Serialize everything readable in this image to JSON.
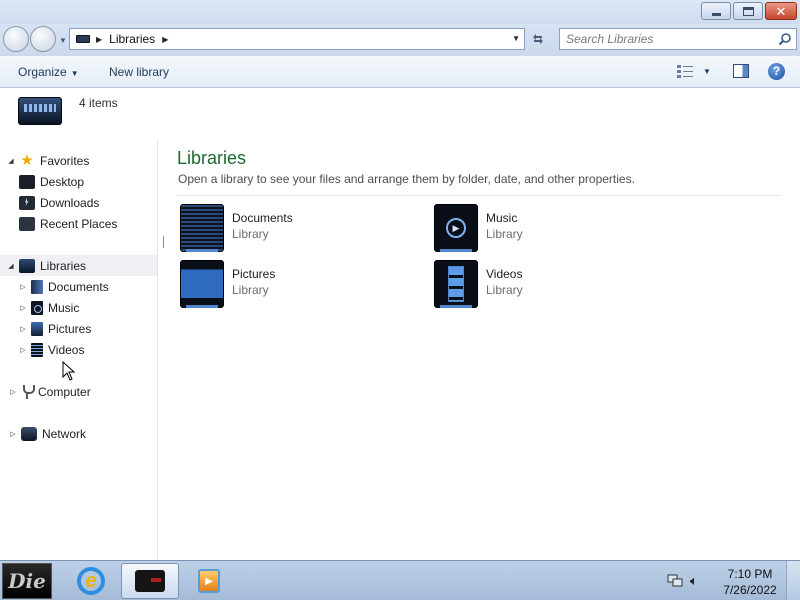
{
  "window": {
    "controls": {
      "minimize_icon": "minimize-icon",
      "maximize_icon": "restore-icon",
      "close_icon": "close-icon"
    }
  },
  "address_bar": {
    "breadcrumbs": [
      "Libraries"
    ],
    "search_placeholder": "Search Libraries"
  },
  "command_bar": {
    "organize_label": "Organize",
    "new_library_label": "New library"
  },
  "details": {
    "item_count": "4 items"
  },
  "navigation": {
    "favorites": {
      "label": "Favorites",
      "items": [
        {
          "label": "Desktop",
          "icon": "desktop-icon"
        },
        {
          "label": "Downloads",
          "icon": "downloads-icon"
        },
        {
          "label": "Recent Places",
          "icon": "recent-places-icon"
        }
      ]
    },
    "libraries": {
      "label": "Libraries",
      "items": [
        {
          "label": "Documents",
          "icon": "documents-icon"
        },
        {
          "label": "Music",
          "icon": "music-icon"
        },
        {
          "label": "Pictures",
          "icon": "pictures-icon"
        },
        {
          "label": "Videos",
          "icon": "videos-icon"
        }
      ]
    },
    "computer": {
      "label": "Computer"
    },
    "network": {
      "label": "Network"
    }
  },
  "main": {
    "title": "Libraries",
    "description": "Open a library to see your files and arrange them by folder, date, and other properties.",
    "libraries": [
      {
        "name": "Documents",
        "type": "Library",
        "icon": "documents-library-icon"
      },
      {
        "name": "Music",
        "type": "Library",
        "icon": "music-library-icon"
      },
      {
        "name": "Pictures",
        "type": "Library",
        "icon": "pictures-library-icon"
      },
      {
        "name": "Videos",
        "type": "Library",
        "icon": "videos-library-icon"
      }
    ]
  },
  "taskbar": {
    "start_label": "Die",
    "time": "7:10 PM",
    "date": "7/26/2022"
  },
  "colors": {
    "title_green": "#1e6b2e",
    "link_blue": "#1e395b",
    "close_red": "#c6452a"
  }
}
